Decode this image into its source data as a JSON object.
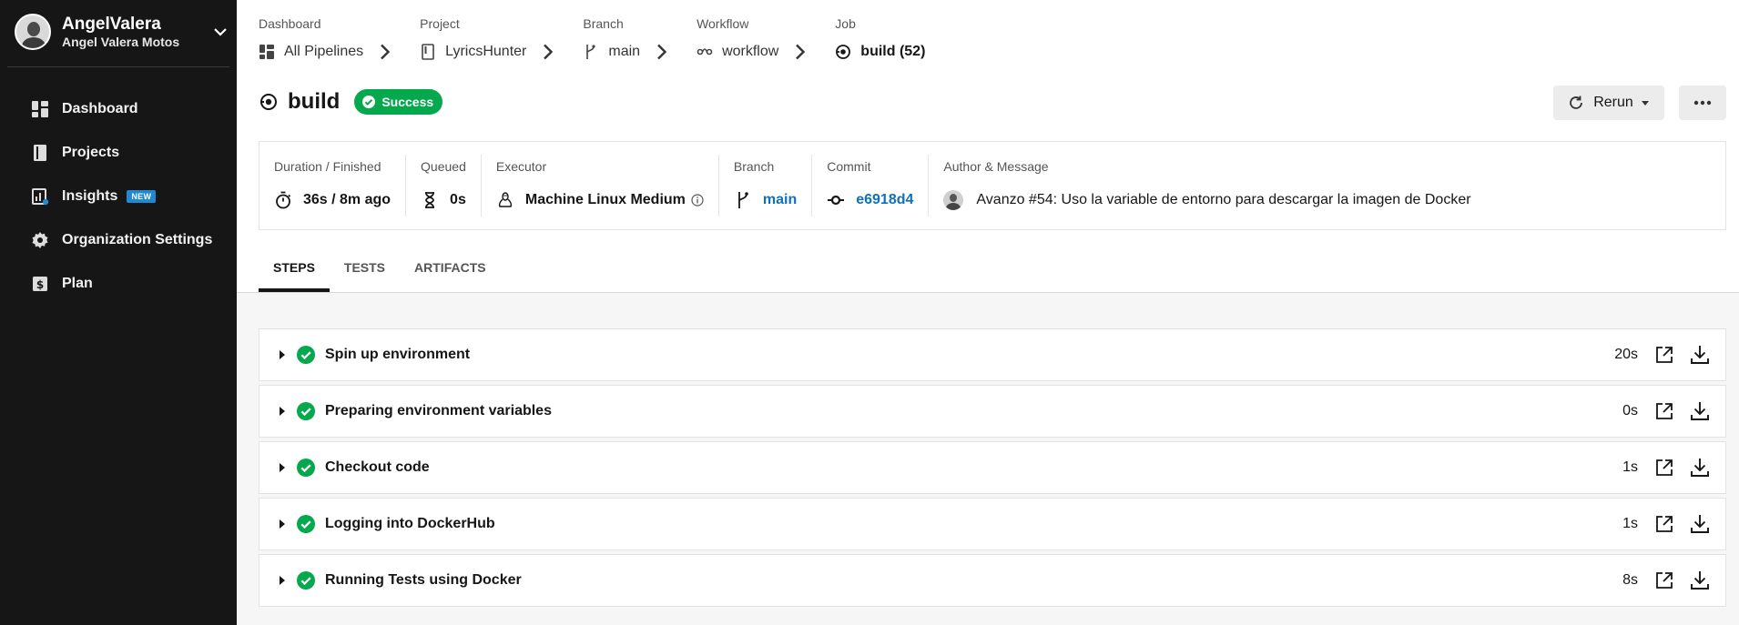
{
  "sidebar": {
    "org_name": "AngelValera",
    "org_subtitle": "Angel Valera Motos",
    "items": [
      {
        "label": "Dashboard",
        "icon": "dashboard-icon"
      },
      {
        "label": "Projects",
        "icon": "book-icon"
      },
      {
        "label": "Insights",
        "icon": "insights-icon",
        "badge": "NEW"
      },
      {
        "label": "Organization Settings",
        "icon": "gear-icon"
      },
      {
        "label": "Plan",
        "icon": "dollar-icon"
      }
    ]
  },
  "breadcrumb": [
    {
      "label": "Dashboard",
      "value": "All Pipelines",
      "icon": "pipelines-icon"
    },
    {
      "label": "Project",
      "value": "LyricsHunter",
      "icon": "book-icon"
    },
    {
      "label": "Branch",
      "value": "main",
      "icon": "branch-icon"
    },
    {
      "label": "Workflow",
      "value": "workflow",
      "icon": "workflow-icon"
    },
    {
      "label": "Job",
      "value": "build (52)",
      "icon": "job-icon"
    }
  ],
  "header": {
    "title": "build",
    "status": "Success",
    "rerun_label": "Rerun"
  },
  "info": {
    "duration_label": "Duration / Finished",
    "duration_value": "36s / 8m ago",
    "queued_label": "Queued",
    "queued_value": "0s",
    "executor_label": "Executor",
    "executor_value": "Machine Linux Medium",
    "branch_label": "Branch",
    "branch_value": "main",
    "commit_label": "Commit",
    "commit_value": "e6918d4",
    "author_label": "Author & Message",
    "author_message": "Avanzo #54: Uso la variable de entorno para descargar la imagen de Docker"
  },
  "tabs": [
    {
      "label": "STEPS",
      "active": true
    },
    {
      "label": "TESTS",
      "active": false
    },
    {
      "label": "ARTIFACTS",
      "active": false
    }
  ],
  "steps": [
    {
      "name": "Spin up environment",
      "duration": "20s"
    },
    {
      "name": "Preparing environment variables",
      "duration": "0s"
    },
    {
      "name": "Checkout code",
      "duration": "1s"
    },
    {
      "name": "Logging into DockerHub",
      "duration": "1s"
    },
    {
      "name": "Running Tests using Docker",
      "duration": "8s"
    }
  ],
  "colors": {
    "sidebar_bg": "#161616",
    "success": "#04a84d",
    "link": "#0f71bd",
    "badge_new": "#1f8ad2"
  }
}
